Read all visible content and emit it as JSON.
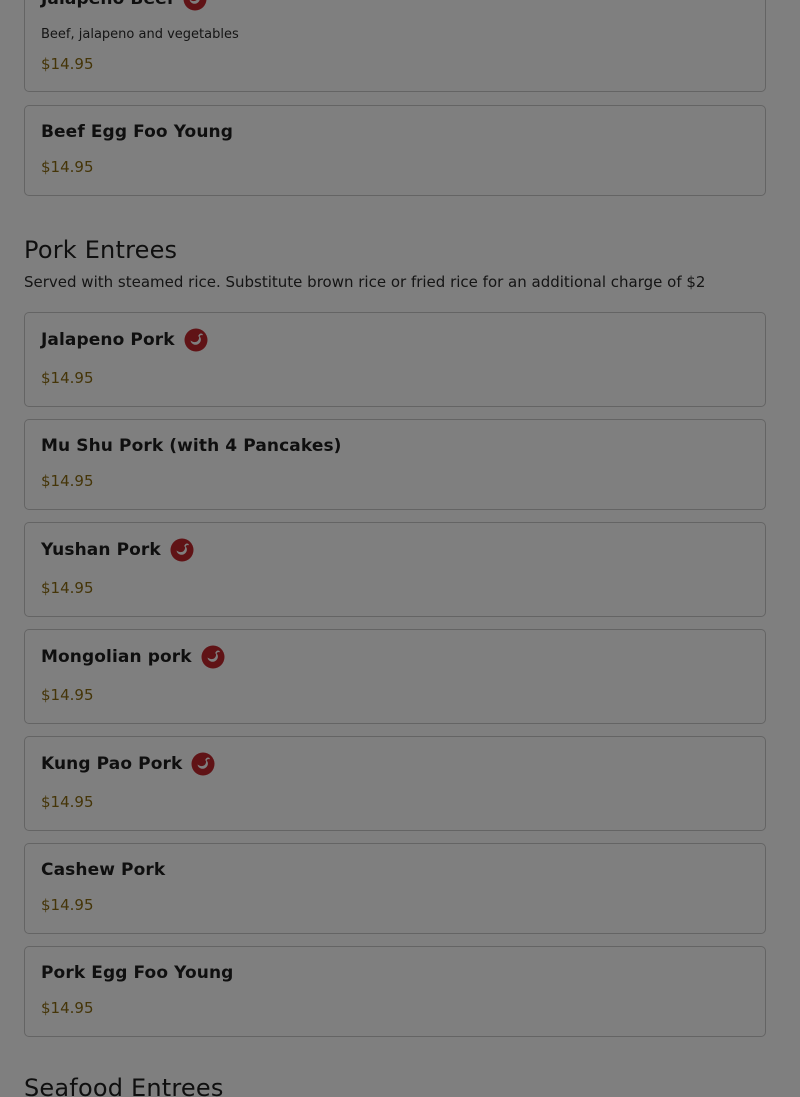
{
  "top_card": {
    "name": "Jalapeno Beef",
    "description": "Beef, jalapeno and vegetables",
    "price": "$14.95"
  },
  "beef_egg_foo_young": {
    "name": "Beef Egg Foo Young",
    "price": "$14.95"
  },
  "pork_section": {
    "title": "Pork Entrees",
    "note": "Served with steamed rice. Substitute brown rice or fried rice for an additional charge of $2",
    "items": [
      {
        "name": "Jalapeno Pork",
        "price": "$14.95",
        "icon": "spicy-icon"
      },
      {
        "name": "Mu Shu Pork (with 4 Pancakes)",
        "price": "$14.95"
      },
      {
        "name": "Yushan Pork",
        "price": "$14.95",
        "icon": "spicy-icon"
      },
      {
        "name": "Mongolian pork",
        "price": "$14.95",
        "icon": "spicy-icon"
      },
      {
        "name": "Kung Pao Pork",
        "price": "$14.95",
        "icon": "spicy-icon"
      },
      {
        "name": "Cashew Pork",
        "price": "$14.95"
      },
      {
        "name": "Pork Egg Foo Young",
        "price": "$14.95"
      }
    ]
  },
  "seafood_section": {
    "title": "Seafood Entrees"
  },
  "colors": {
    "overlay": "rgba(0,0,0,0.5)",
    "price": "#8a6a10",
    "spicy_icon": "#c1272d"
  }
}
